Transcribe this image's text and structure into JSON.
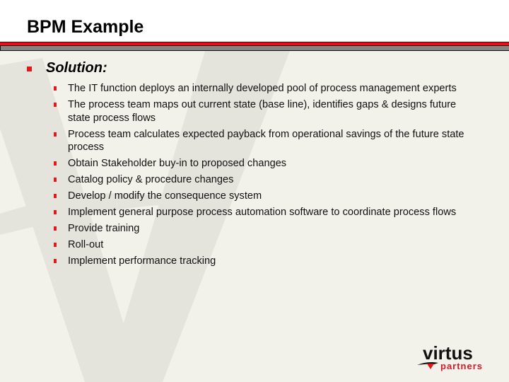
{
  "slide": {
    "title": "BPM Example",
    "section_label": "Solution:",
    "items": [
      {
        "text": "The IT function deploys an internally developed pool of process management experts"
      },
      {
        "text": "The process team maps out current state (base line), identifies gaps & designs future state process flows"
      },
      {
        "text": "Process team calculates expected payback from operational savings of the future state process"
      },
      {
        "text": "Obtain Stakeholder buy-in to proposed changes"
      },
      {
        "text": "Catalog policy & procedure changes"
      },
      {
        "text": "Develop / modify the consequence system"
      },
      {
        "text": "Implement general purpose process automation software to coordinate process flows"
      },
      {
        "text": "Provide training"
      },
      {
        "text": "Roll-out"
      },
      {
        "text": "Implement performance tracking"
      }
    ]
  },
  "logo": {
    "word_main": "virtus",
    "word_sub": "partners"
  },
  "colors": {
    "accent_red": "#e5101a",
    "bar_gray": "#848484",
    "background": "#f2f1ea"
  }
}
